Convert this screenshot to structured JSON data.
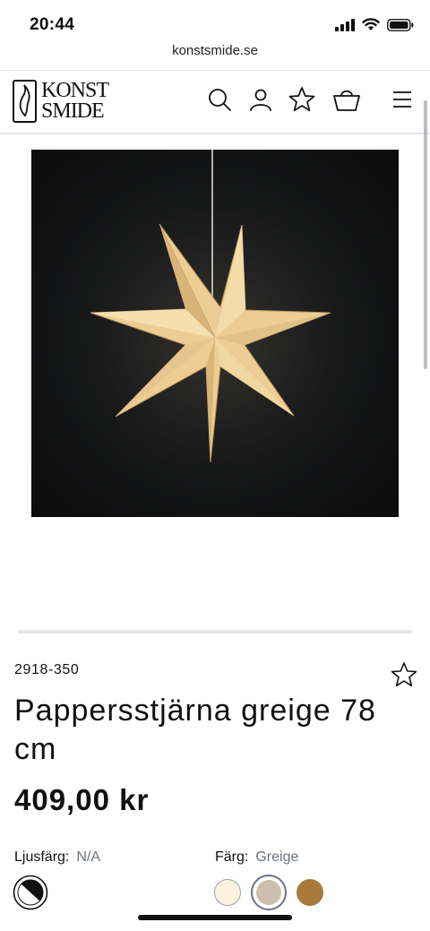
{
  "status_bar": {
    "time": "20:44"
  },
  "browser": {
    "url": "konstsmide.se"
  },
  "header": {
    "logo_line1": "KONST",
    "logo_line2": "SMIDE"
  },
  "product": {
    "sku": "2918-350",
    "title": "Pappersstjärna greige 78 cm",
    "price": "409,00 kr",
    "light_color": {
      "label": "Ljusfärg:",
      "value": "N/A"
    },
    "color": {
      "label": "Färg:",
      "value": "Greige",
      "swatches": [
        {
          "name": "cream",
          "hex": "#fbf3de",
          "selected": false
        },
        {
          "name": "greige",
          "hex": "#cdbfae",
          "selected": true
        },
        {
          "name": "brown",
          "hex": "#a8793a",
          "selected": false
        }
      ]
    }
  },
  "colors": {
    "star_light": "#f5d7a1",
    "star_shadow": "#b8925a",
    "image_bg": "#141516"
  }
}
